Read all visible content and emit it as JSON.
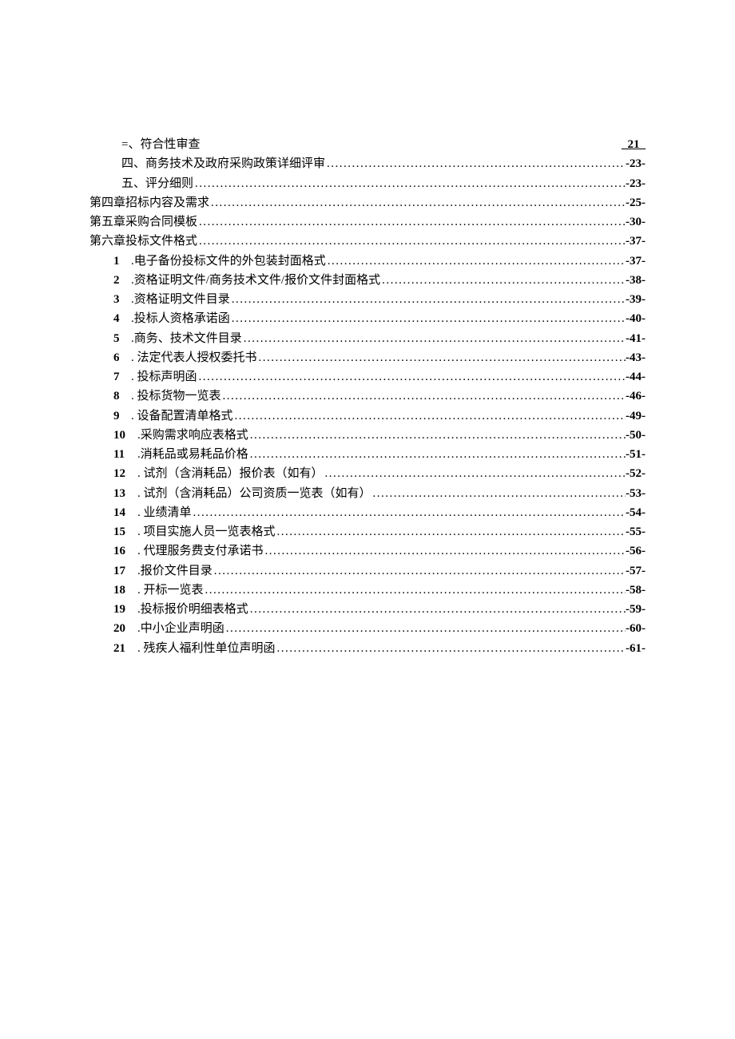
{
  "toc": {
    "sub_items_first": [
      {
        "label": "=、符合性审查",
        "page": "_21_",
        "dots": false,
        "underline_page": true
      },
      {
        "label": "四、商务技术及政府采购政策详细评审",
        "page": "-23-",
        "dots": true
      },
      {
        "label": "五、评分细则",
        "page": "-23-",
        "dots": true
      }
    ],
    "chapters": [
      {
        "label": "第四章招标内容及需求",
        "page": "-25-"
      },
      {
        "label": "第五章采购合同模板",
        "page": "-30-"
      },
      {
        "label": "第六章投标文件格式",
        "page": "-37-"
      }
    ],
    "numbered_items": [
      {
        "num": "1",
        "label": ".电子备份投标文件的外包装封面格式",
        "page": "-37-"
      },
      {
        "num": "2",
        "label": ".资格证明文件/商务技术文件/报价文件封面格式",
        "page": "-38-"
      },
      {
        "num": "3",
        "label": ".资格证明文件目录",
        "page": "-39-"
      },
      {
        "num": "4",
        "label": ".投标人资格承诺函",
        "page": "-40-"
      },
      {
        "num": "5",
        "label": ".商务、技术文件目录",
        "page": "-41-"
      },
      {
        "num": "6",
        "label": ". 法定代表人授权委托书",
        "page": "-43-"
      },
      {
        "num": "7",
        "label": ". 投标声明函",
        "page": "-44-"
      },
      {
        "num": "8",
        "label": ". 投标货物一览表",
        "page": "-46-"
      },
      {
        "num": "9",
        "label": ". 设备配置清单格式",
        "page": "-49-"
      },
      {
        "num": "10",
        "label": ".采购需求响应表格式",
        "page": "-50-"
      },
      {
        "num": "11",
        "label": ".消耗品或易耗品价格",
        "page": "-51-"
      },
      {
        "num": "12",
        "label": ". 试剂（含消耗品）报价表（如有）",
        "page": "-52-"
      },
      {
        "num": "13",
        "label": ". 试剂（含消耗品）公司资质一览表（如有）",
        "page": "-53-"
      },
      {
        "num": "14",
        "label": ". 业绩清单",
        "page": "-54-"
      },
      {
        "num": "15",
        "label": ". 项目实施人员一览表格式",
        "page": "-55-"
      },
      {
        "num": "16",
        "label": ". 代理服务费支付承诺书",
        "page": "-56-"
      },
      {
        "num": "17",
        "label": ".报价文件目录",
        "page": "-57-"
      },
      {
        "num": "18",
        "label": ". 开标一览表",
        "page": "-58-"
      },
      {
        "num": "19",
        "label": ".投标报价明细表格式",
        "page": "-59-"
      },
      {
        "num": "20",
        "label": ".中小企业声明函",
        "page": "-60-"
      },
      {
        "num": "21",
        "label": ". 残疾人福利性单位声明函",
        "page": "-61-"
      }
    ]
  }
}
